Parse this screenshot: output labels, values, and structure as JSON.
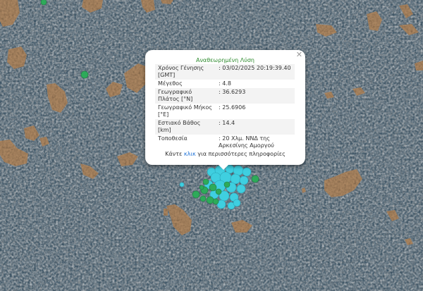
{
  "colors": {
    "sea": "#1f3d52",
    "land": "#b58e67",
    "quake_cyan": "#3fcfe0",
    "quake_green": "#2eaa5a",
    "popup_title": "#2e8b2e",
    "link": "#1a6fd6"
  },
  "popup": {
    "title": "Αναθεωρημένη Λύση",
    "close_icon": "close-icon",
    "rows": [
      {
        "label": "Χρόνος Γένησης [GMT]",
        "value": ": 03/02/2025 20:19:39.40"
      },
      {
        "label": "Μέγεθος",
        "value": ": 4.8"
      },
      {
        "label": "Γεωγραφικό Πλάτος [°N]",
        "value": ": 36.6293"
      },
      {
        "label": "Γεωγραφικό Μήκος [°E]",
        "value": ": 25.6906"
      },
      {
        "label": "Εστιακό Βάθος [km]",
        "value": ": 14.4"
      },
      {
        "label": "Τοποθεσία",
        "value": ": 20 Χλμ. ΝΝΔ της Αρκεσίνης Αμοργού"
      }
    ],
    "more_prefix": "Κάντε ",
    "more_link": "κλικ",
    "more_suffix": " για περισσότερες πληροφορίες"
  }
}
